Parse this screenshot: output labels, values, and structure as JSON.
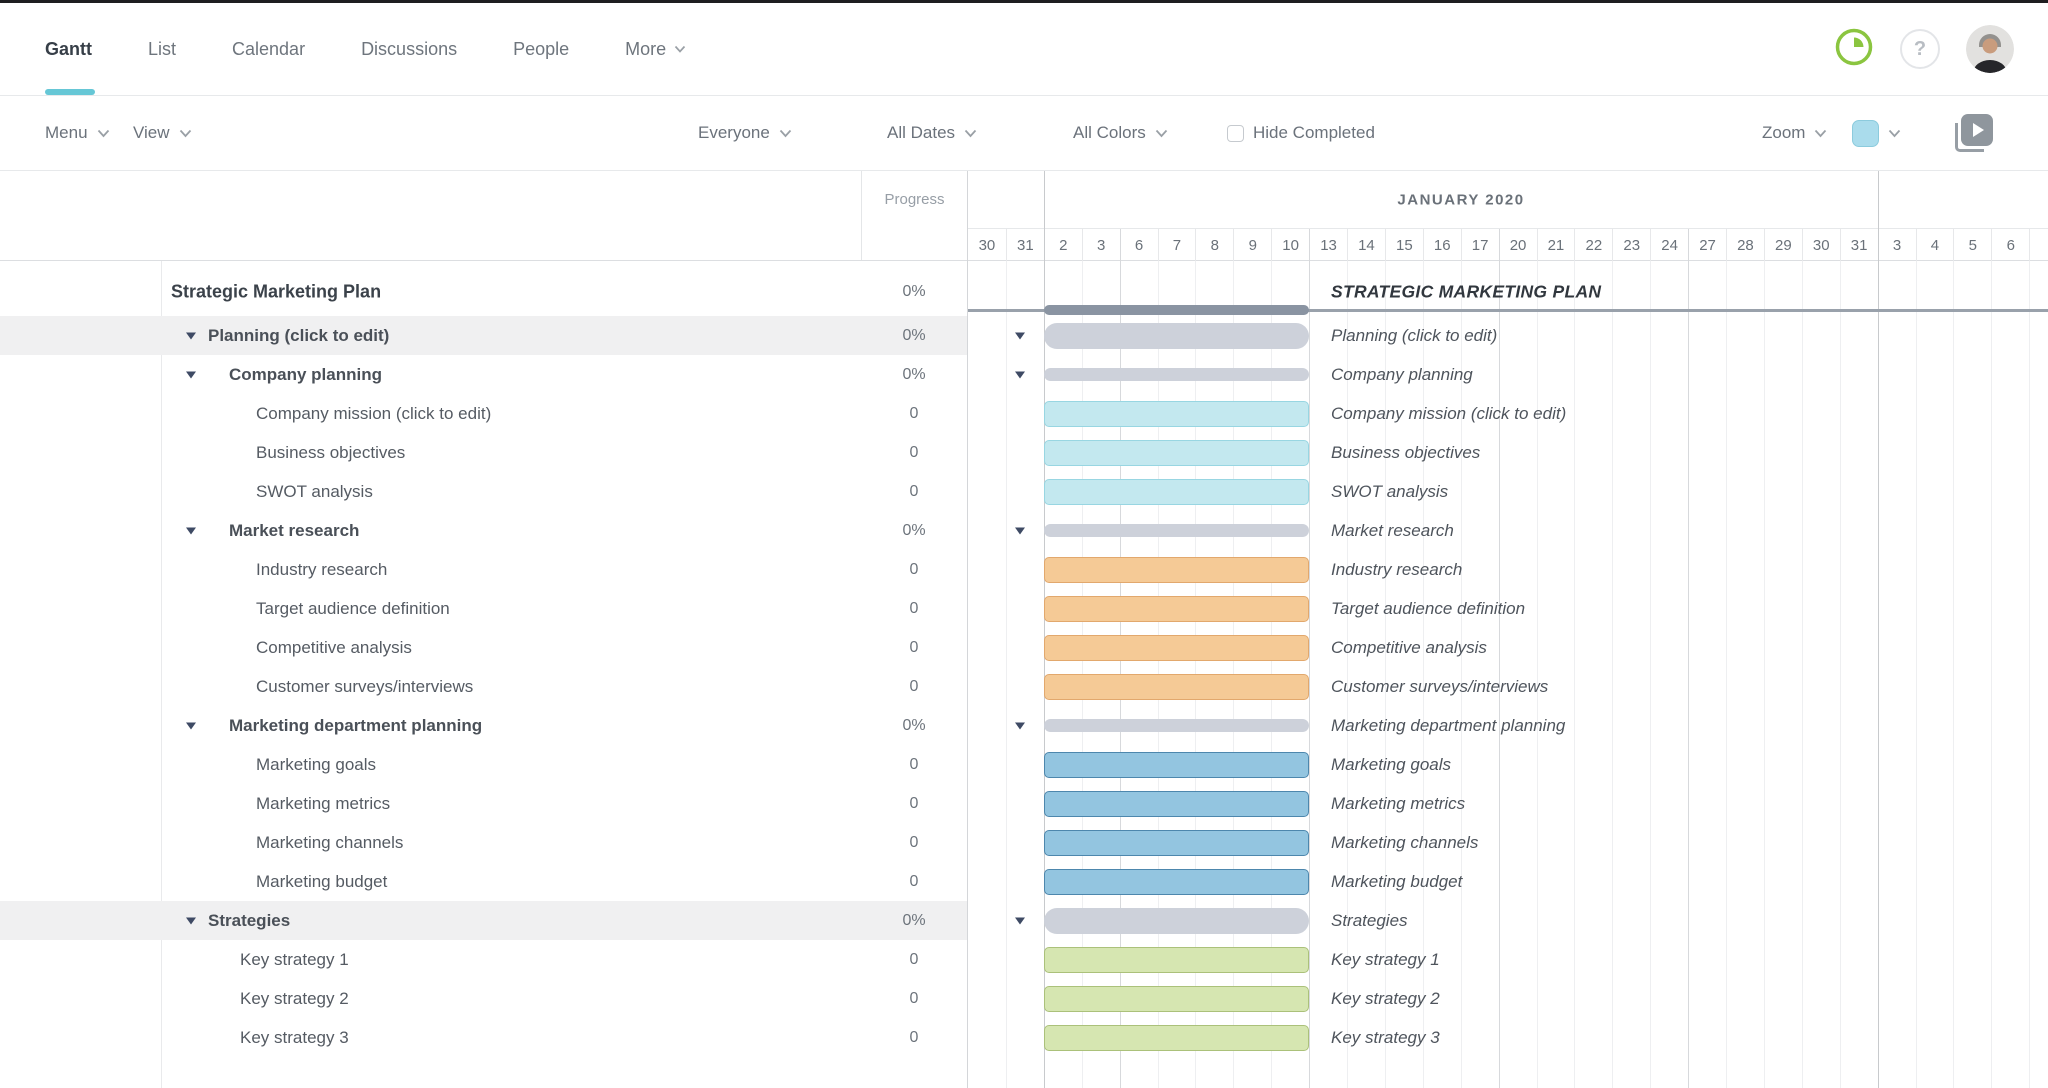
{
  "nav": {
    "tabs": [
      {
        "label": "Gantt",
        "active": true,
        "chevron": false
      },
      {
        "label": "List",
        "active": false,
        "chevron": false
      },
      {
        "label": "Calendar",
        "active": false,
        "chevron": false
      },
      {
        "label": "Discussions",
        "active": false,
        "chevron": false
      },
      {
        "label": "People",
        "active": false,
        "chevron": false
      },
      {
        "label": "More",
        "active": false,
        "chevron": true
      }
    ],
    "help_glyph": "?"
  },
  "toolbar": {
    "menu_label": "Menu",
    "view_label": "View",
    "everyone_label": "Everyone",
    "all_dates_label": "All Dates",
    "all_colors_label": "All Colors",
    "hide_completed_label": "Hide Completed",
    "hide_completed_checked": false,
    "zoom_label": "Zoom"
  },
  "table_header": {
    "progress_label": "Progress"
  },
  "timeline": {
    "month_label": "JANUARY 2020",
    "days": [
      {
        "label": "30",
        "sep": "none"
      },
      {
        "label": "31",
        "sep": "day"
      },
      {
        "label": "2",
        "sep": "month"
      },
      {
        "label": "3",
        "sep": "day"
      },
      {
        "label": "6",
        "sep": "week"
      },
      {
        "label": "7",
        "sep": "day"
      },
      {
        "label": "8",
        "sep": "day"
      },
      {
        "label": "9",
        "sep": "day"
      },
      {
        "label": "10",
        "sep": "day"
      },
      {
        "label": "13",
        "sep": "week"
      },
      {
        "label": "14",
        "sep": "day"
      },
      {
        "label": "15",
        "sep": "day"
      },
      {
        "label": "16",
        "sep": "day"
      },
      {
        "label": "17",
        "sep": "day"
      },
      {
        "label": "20",
        "sep": "week"
      },
      {
        "label": "21",
        "sep": "day"
      },
      {
        "label": "22",
        "sep": "day"
      },
      {
        "label": "23",
        "sep": "day"
      },
      {
        "label": "24",
        "sep": "day"
      },
      {
        "label": "27",
        "sep": "week"
      },
      {
        "label": "28",
        "sep": "day"
      },
      {
        "label": "29",
        "sep": "day"
      },
      {
        "label": "30",
        "sep": "day"
      },
      {
        "label": "31",
        "sep": "day"
      },
      {
        "label": "3",
        "sep": "month"
      },
      {
        "label": "4",
        "sep": "day"
      },
      {
        "label": "5",
        "sep": "day"
      },
      {
        "label": "6",
        "sep": "day"
      },
      {
        "label": "",
        "sep": "day"
      }
    ],
    "bars_start_day": "Jan 2",
    "bars_end_day": "Jan 10"
  },
  "project": {
    "title": "Strategic Marketing Plan",
    "progress": "0%",
    "chart_label": "STRATEGIC MARKETING PLAN"
  },
  "rows": [
    {
      "label": "Planning (click to edit)",
      "progress": "0%",
      "level": 1,
      "kind": "group",
      "color": "gray",
      "highlight": true
    },
    {
      "label": "Company planning",
      "progress": "0%",
      "level": 2,
      "kind": "group",
      "color": "gray",
      "highlight": false
    },
    {
      "label": "Company mission (click to edit)",
      "progress": "0",
      "level": 3,
      "kind": "task",
      "color": "cyan",
      "highlight": false
    },
    {
      "label": "Business objectives",
      "progress": "0",
      "level": 3,
      "kind": "task",
      "color": "cyan",
      "highlight": false
    },
    {
      "label": "SWOT analysis",
      "progress": "0",
      "level": 3,
      "kind": "task",
      "color": "cyan",
      "highlight": false
    },
    {
      "label": "Market research",
      "progress": "0%",
      "level": 2,
      "kind": "group",
      "color": "gray",
      "highlight": false
    },
    {
      "label": "Industry research",
      "progress": "0",
      "level": 3,
      "kind": "task",
      "color": "orange",
      "highlight": false
    },
    {
      "label": "Target audience definition",
      "progress": "0",
      "level": 3,
      "kind": "task",
      "color": "orange",
      "highlight": false
    },
    {
      "label": "Competitive analysis",
      "progress": "0",
      "level": 3,
      "kind": "task",
      "color": "orange",
      "highlight": false
    },
    {
      "label": "Customer surveys/interviews",
      "progress": "0",
      "level": 3,
      "kind": "task",
      "color": "orange",
      "highlight": false
    },
    {
      "label": "Marketing department planning",
      "progress": "0%",
      "level": 2,
      "kind": "group",
      "color": "gray",
      "highlight": false
    },
    {
      "label": "Marketing goals",
      "progress": "0",
      "level": 3,
      "kind": "task",
      "color": "blue",
      "highlight": false
    },
    {
      "label": "Marketing metrics",
      "progress": "0",
      "level": 3,
      "kind": "task",
      "color": "blue",
      "highlight": false
    },
    {
      "label": "Marketing channels",
      "progress": "0",
      "level": 3,
      "kind": "task",
      "color": "blue",
      "highlight": false
    },
    {
      "label": "Marketing budget",
      "progress": "0",
      "level": 3,
      "kind": "task",
      "color": "blue",
      "highlight": false
    },
    {
      "label": "Strategies",
      "progress": "0%",
      "level": 1,
      "kind": "group",
      "color": "gray",
      "highlight": true
    },
    {
      "label": "Key strategy 1",
      "progress": "0",
      "level": 2,
      "kind": "task",
      "color": "green",
      "highlight": false
    },
    {
      "label": "Key strategy 2",
      "progress": "0",
      "level": 2,
      "kind": "task",
      "color": "green",
      "highlight": false
    },
    {
      "label": "Key strategy 3",
      "progress": "0",
      "level": 2,
      "kind": "task",
      "color": "green",
      "highlight": false
    }
  ],
  "colors": {
    "accent_underline": "#66c7d6",
    "clock_green": "#8bc540",
    "swatch_fill": "#aadcec",
    "swatch_border": "#8ccbdd",
    "group_bar": "#cdd1da",
    "project_bar": "#8a94a2",
    "bars": {
      "cyan": {
        "fill": "#c3e8ef",
        "border": "#98d6e2"
      },
      "orange": {
        "fill": "#f5ca96",
        "border": "#e2a86d"
      },
      "blue": {
        "fill": "#93c5e0",
        "border": "#4d87ad"
      },
      "green": {
        "fill": "#d6e6b1",
        "border": "#abc17a"
      }
    }
  }
}
